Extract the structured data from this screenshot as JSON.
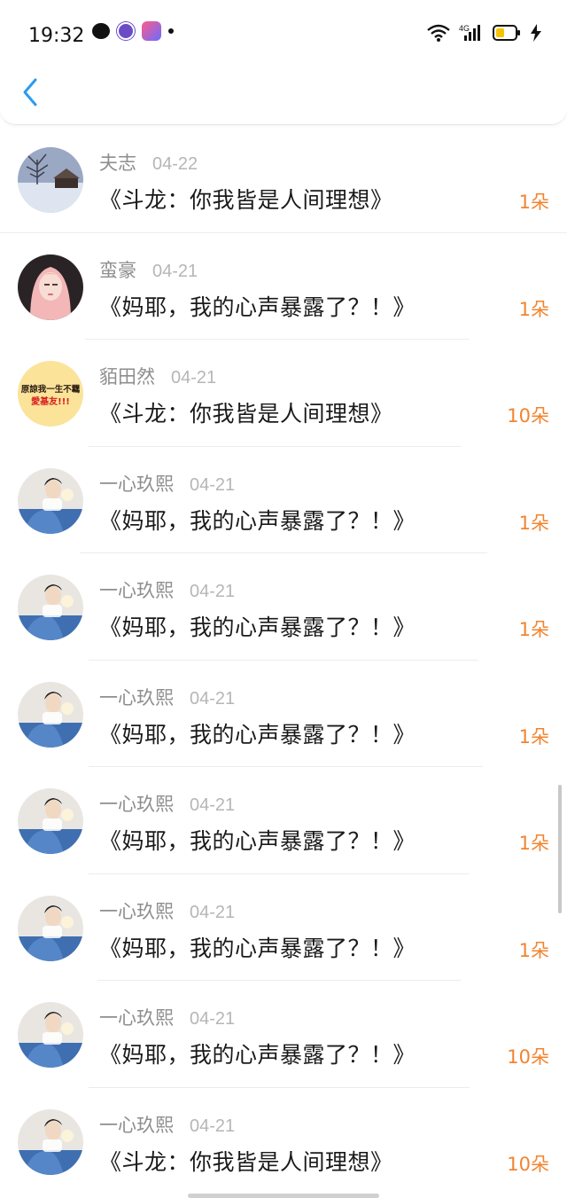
{
  "status_bar": {
    "time": "19:32",
    "network": "4G",
    "icons": [
      "wechat-icon",
      "circle-app-icon",
      "gradient-app-icon",
      "dot-icon",
      "wifi-icon",
      "signal-icon",
      "battery-icon",
      "charging-bolt-icon"
    ]
  },
  "nav": {
    "back_icon": "chevron-left-icon",
    "accent": "#2a9bf0"
  },
  "accent_count_color": "#f2842f",
  "rows": [
    {
      "name": "夫志",
      "date": "04-22",
      "book": "《斗龙：你我皆是人间理想》",
      "count": "1朵",
      "avatar": "winter-cabin"
    },
    {
      "name": "蛮豪",
      "date": "04-21",
      "book": "《妈耶，我的心声暴露了？！》",
      "count": "1朵",
      "avatar": "pink-girl"
    },
    {
      "name": "貊田然",
      "date": "04-21",
      "book": "《斗龙：你我皆是人间理想》",
      "count": "10朵",
      "avatar": "text-sticker",
      "avatar_text": [
        "原諒我一生不羈",
        "愛基友!!!"
      ]
    },
    {
      "name": "一心玖熙",
      "date": "04-21",
      "book": "《妈耶，我的心声暴露了？！》",
      "count": "1朵",
      "avatar": "boy-photo"
    },
    {
      "name": "一心玖熙",
      "date": "04-21",
      "book": "《妈耶，我的心声暴露了？！》",
      "count": "1朵",
      "avatar": "boy-photo"
    },
    {
      "name": "一心玖熙",
      "date": "04-21",
      "book": "《妈耶，我的心声暴露了？！》",
      "count": "1朵",
      "avatar": "boy-photo"
    },
    {
      "name": "一心玖熙",
      "date": "04-21",
      "book": "《妈耶，我的心声暴露了？！》",
      "count": "1朵",
      "avatar": "boy-photo"
    },
    {
      "name": "一心玖熙",
      "date": "04-21",
      "book": "《妈耶，我的心声暴露了？！》",
      "count": "1朵",
      "avatar": "boy-photo"
    },
    {
      "name": "一心玖熙",
      "date": "04-21",
      "book": "《妈耶，我的心声暴露了？！》",
      "count": "10朵",
      "avatar": "boy-photo"
    },
    {
      "name": "一心玖熙",
      "date": "04-21",
      "book": "《斗龙：你我皆是人间理想》",
      "count": "10朵",
      "avatar": "boy-photo"
    }
  ]
}
